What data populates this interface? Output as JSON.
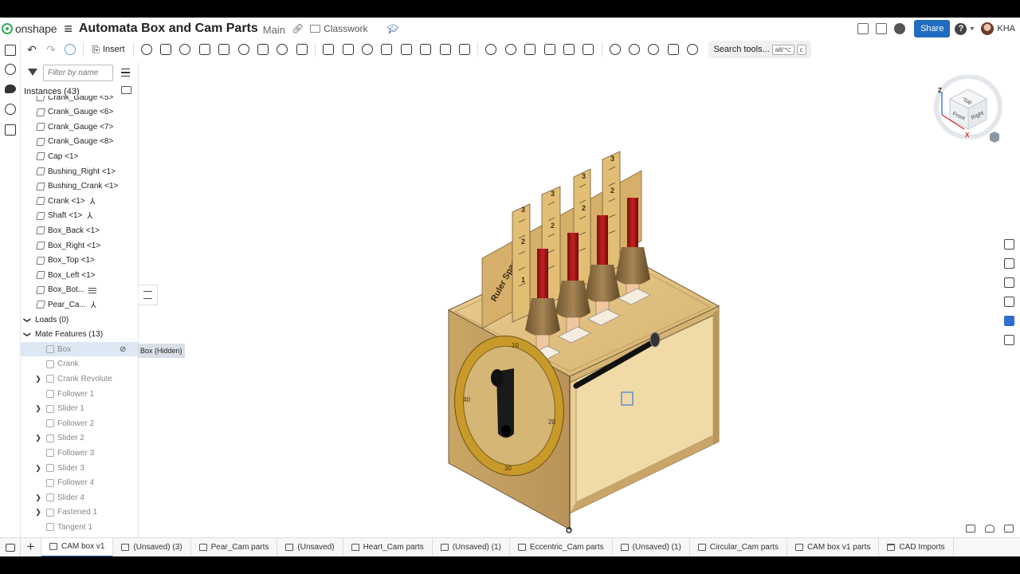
{
  "header": {
    "logo_text": "onshape",
    "document_title": "Automata Box and Cam Parts",
    "branch": "Main",
    "folder": "Classwork",
    "share_label": "Share",
    "help_label": "?",
    "user_initials": "KHA"
  },
  "toolbar": {
    "insert_label": "Insert",
    "search_tools_label": "Search tools...",
    "shortcut_keys": [
      "alt/⌥",
      "c"
    ]
  },
  "panel": {
    "filter_placeholder": "Filter by name",
    "instances_header": "Instances (43)",
    "instances": [
      {
        "label": "Crank_Gauge <5>",
        "badge": ""
      },
      {
        "label": "Crank_Gauge <6>",
        "badge": ""
      },
      {
        "label": "Crank_Gauge <7>",
        "badge": ""
      },
      {
        "label": "Crank_Gauge <8>",
        "badge": ""
      },
      {
        "label": "Cap <1>",
        "badge": ""
      },
      {
        "label": "Bushing_Right <1>",
        "badge": ""
      },
      {
        "label": "Bushing_Crank <1>",
        "badge": ""
      },
      {
        "label": "Crank <1>",
        "badge": "fixed"
      },
      {
        "label": "Shaft <1>",
        "badge": "fixed"
      },
      {
        "label": "Box_Back <1>",
        "badge": ""
      },
      {
        "label": "Box_Right <1>",
        "badge": ""
      },
      {
        "label": "Box_Top <1>",
        "badge": ""
      },
      {
        "label": "Box_Left <1>",
        "badge": ""
      },
      {
        "label": "Box_Bot...",
        "badge": "stripes"
      },
      {
        "label": "Pear_Ca...",
        "badge": "fixed"
      }
    ],
    "loads_label": "Loads (0)",
    "mate_features_label": "Mate Features (13)",
    "mates": [
      {
        "label": "Box",
        "expandable": false,
        "highlight": true
      },
      {
        "label": "Crank",
        "expandable": false,
        "highlight": false
      },
      {
        "label": "Crank Revolute",
        "expandable": true,
        "highlight": false
      },
      {
        "label": "Follower 1",
        "expandable": false,
        "highlight": false
      },
      {
        "label": "Slider 1",
        "expandable": true,
        "highlight": false
      },
      {
        "label": "Follower 2",
        "expandable": false,
        "highlight": false
      },
      {
        "label": "Slider 2",
        "expandable": true,
        "highlight": false
      },
      {
        "label": "Follower 3",
        "expandable": false,
        "highlight": false
      },
      {
        "label": "Slider 3",
        "expandable": true,
        "highlight": false
      },
      {
        "label": "Follower 4",
        "expandable": false,
        "highlight": false
      },
      {
        "label": "Slider 4",
        "expandable": true,
        "highlight": false
      },
      {
        "label": "Fastened 1",
        "expandable": true,
        "highlight": false
      },
      {
        "label": "Tangent 1",
        "expandable": false,
        "highlight": false
      }
    ],
    "tooltip": "Box (Hidden)"
  },
  "model": {
    "ruler_text": "Ruler Space",
    "ruler_numbers": [
      "1",
      "2",
      "3"
    ],
    "dial_numbers": [
      "10",
      "20",
      "30",
      "40"
    ]
  },
  "view_cube": {
    "faces": [
      "Top",
      "Front",
      "Right"
    ],
    "axes": [
      "Z",
      "X"
    ]
  },
  "tabs": [
    {
      "label": "CAM box v1",
      "active": true,
      "icon": "assembly"
    },
    {
      "label": "(Unsaved) (3)",
      "active": false,
      "icon": "assembly"
    },
    {
      "label": "Pear_Cam parts",
      "active": false,
      "icon": "partstudio"
    },
    {
      "label": "(Unsaved)",
      "active": false,
      "icon": "assembly"
    },
    {
      "label": "Heart_Cam parts",
      "active": false,
      "icon": "partstudio"
    },
    {
      "label": "(Unsaved) (1)",
      "active": false,
      "icon": "assembly"
    },
    {
      "label": "Eccentric_Cam parts",
      "active": false,
      "icon": "partstudio"
    },
    {
      "label": "(Unsaved) (1)",
      "active": false,
      "icon": "assembly"
    },
    {
      "label": "Circular_Cam parts",
      "active": false,
      "icon": "partstudio"
    },
    {
      "label": "CAM box v1 parts",
      "active": false,
      "icon": "partstudio"
    },
    {
      "label": "CAD Imports",
      "active": false,
      "icon": "folder"
    }
  ],
  "colors": {
    "accent": "#1f6cc0",
    "wood": "#d9b775",
    "brass": "#c89a2a",
    "follower_red": "#b11a1a"
  }
}
